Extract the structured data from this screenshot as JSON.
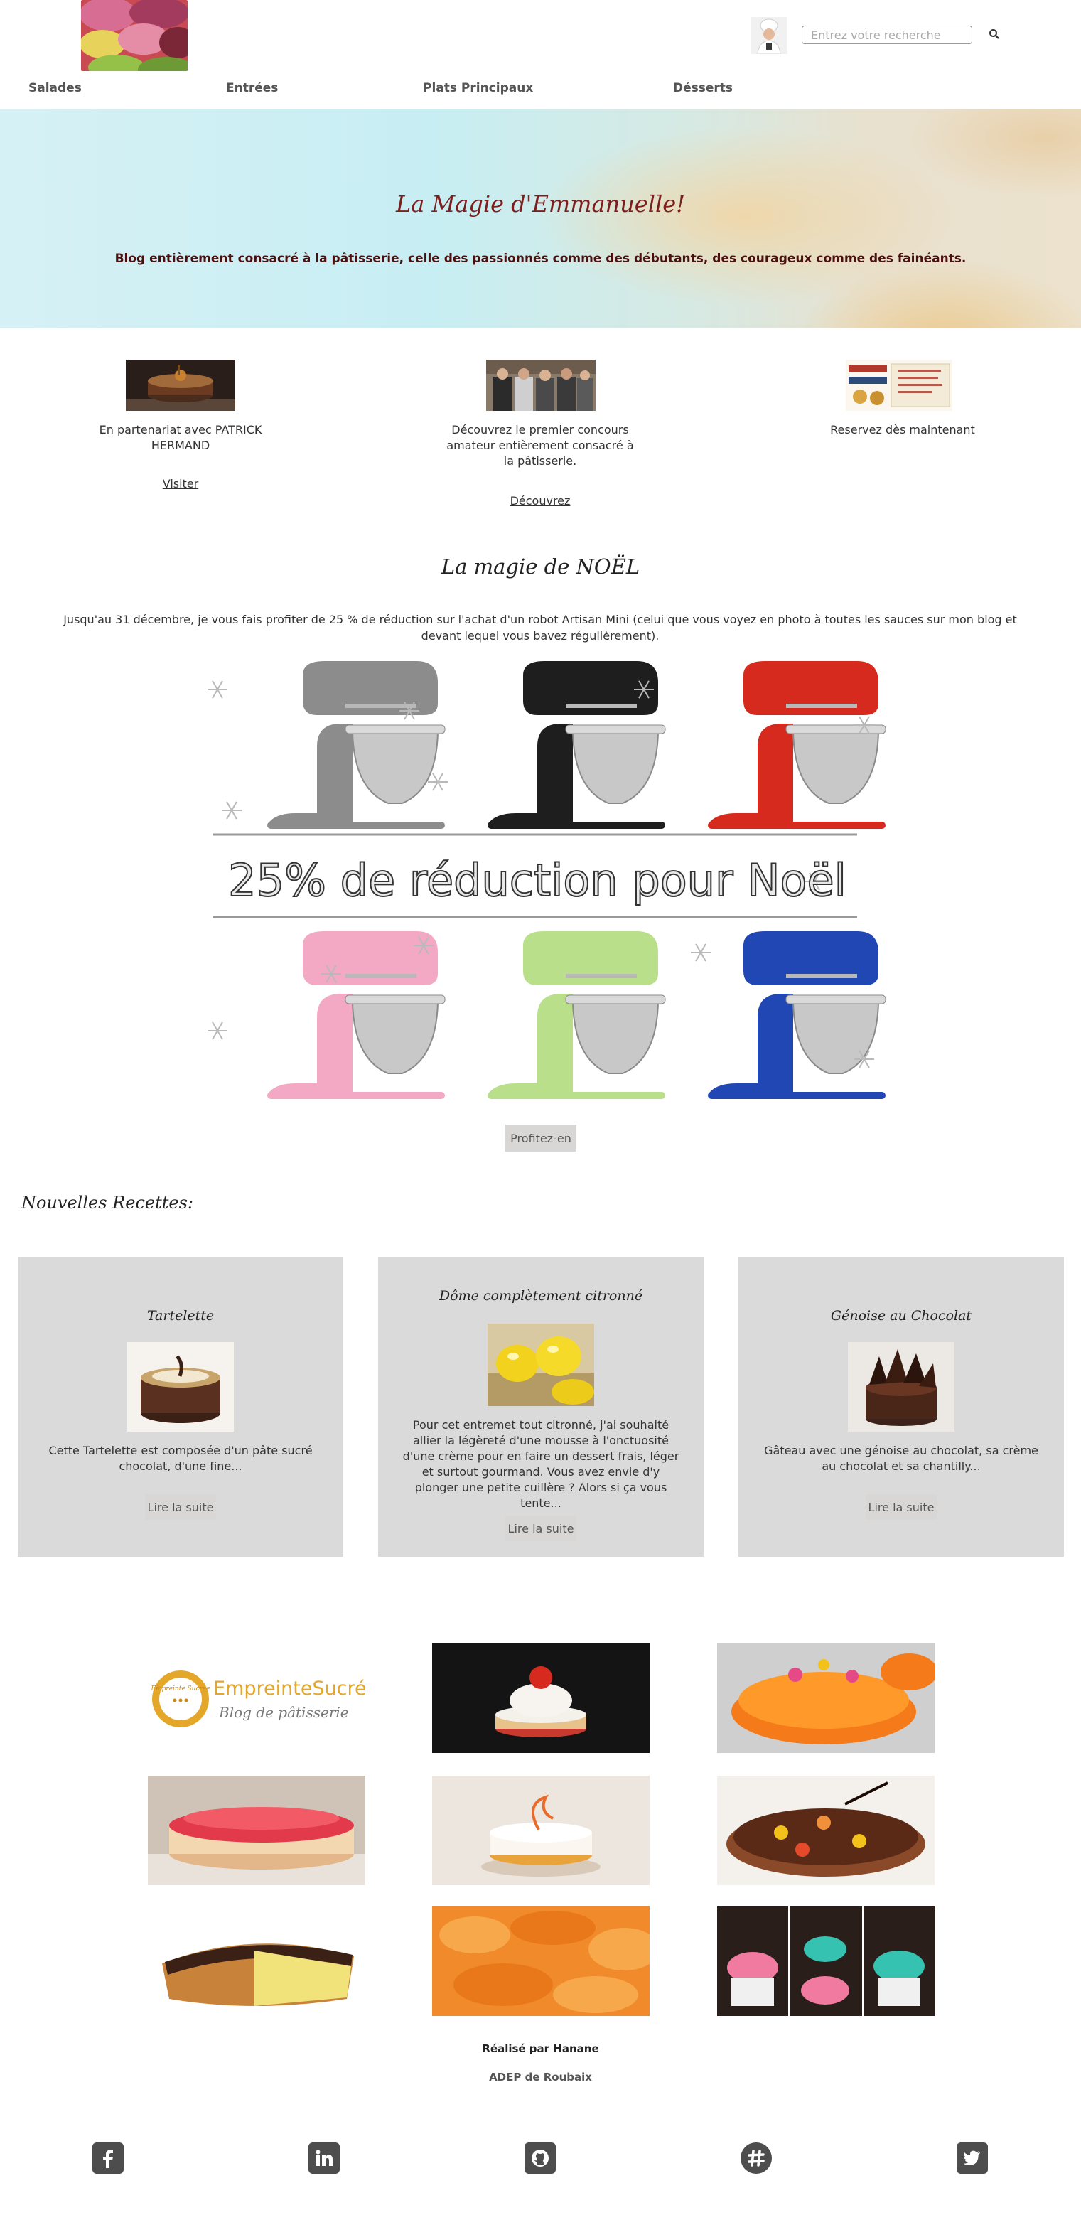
{
  "header": {
    "search": {
      "placeholder": "Entrez votre recherche"
    }
  },
  "nav": {
    "items": [
      {
        "label": "Salades"
      },
      {
        "label": "Entrées"
      },
      {
        "label": "Plats Principaux"
      },
      {
        "label": "Désserts"
      }
    ]
  },
  "hero": {
    "title": "La Magie d'Emmanuelle!",
    "subtitle": "Blog entièrement consacré à la pâtisserie, celle des passionnés comme des débutants, des courageux comme des fainéants."
  },
  "partners": [
    {
      "text": "En partenariat avec PATRICK HERMAND",
      "link": "Visiter"
    },
    {
      "text": "Découvrez le premier concours amateur entièrement consacré à la pâtisserie.",
      "link": "Découvrez"
    },
    {
      "title": "Reservez dès maintenant"
    }
  ],
  "noel": {
    "title": "La magie de NOËL",
    "text": "Jusqu'au 31 décembre, je vous fais profiter de 25 % de réduction sur l'achat d'un robot Artisan Mini (celui que vous voyez en photo à toutes les sauces sur mon blog et devant lequel vous bavez régulièrement).",
    "banner_text": "25% de réduction pour Noël",
    "button": "Profitez-en",
    "colors": [
      "#8c8c8c",
      "#1e1e1e",
      "#d72a1e",
      "#f3a9c3",
      "#b9df8b",
      "#2147b5"
    ]
  },
  "recipes": {
    "title": "Nouvelles Recettes:",
    "cards": [
      {
        "title": "Tartelette",
        "desc": "Cette Tartelette est composée d'un pâte sucré chocolat, d'une fine...",
        "button": "Lire la suite"
      },
      {
        "title": "Dôme complètement citronné",
        "desc": "Pour cet entremet tout citronné, j'ai souhaité allier la légèreté d'une mousse à l'onctuosité d'une crème pour en faire un dessert frais, léger et surtout gourmand. Vous avez envie d'y plonger une petite cuillère ? Alors si ça vous tente...",
        "button": "Lire la suite"
      },
      {
        "title": "Génoise au Chocolat",
        "desc": "Gâteau avec une génoise au chocolat, sa crème au chocolat et sa chantilly...",
        "button": "Lire la suite"
      }
    ]
  },
  "gallery": {
    "logo_text": "EmpreinteSucrée.fr",
    "logo_sub": "Blog de pâtisserie",
    "seal_text": "Empreinte Sucrée"
  },
  "footer": {
    "credit": "Réalisé par Hanane",
    "org": "ADEP de Roubaix",
    "social_icons": [
      "facebook-icon",
      "linkedin-icon",
      "github-icon",
      "slack-icon",
      "twitter-icon"
    ]
  }
}
